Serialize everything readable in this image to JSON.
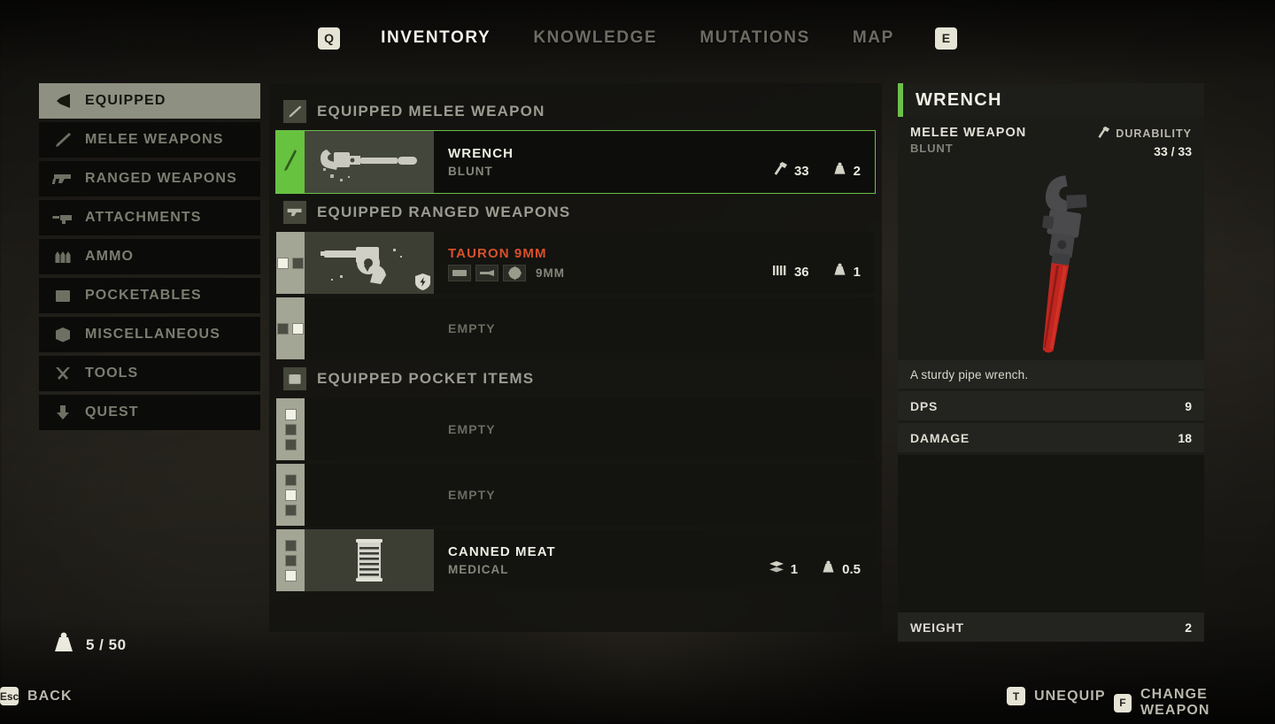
{
  "nav": {
    "left_key": "Q",
    "right_key": "E",
    "tabs": [
      {
        "label": "INVENTORY",
        "active": true
      },
      {
        "label": "KNOWLEDGE",
        "active": false
      },
      {
        "label": "MUTATIONS",
        "active": false
      },
      {
        "label": "MAP",
        "active": false
      }
    ]
  },
  "sidebar": {
    "items": [
      {
        "label": "EQUIPPED",
        "icon": "equipped-icon",
        "active": true
      },
      {
        "label": "MELEE WEAPONS",
        "icon": "blade-icon",
        "active": false
      },
      {
        "label": "RANGED WEAPONS",
        "icon": "pistol-icon",
        "active": false
      },
      {
        "label": "ATTACHMENTS",
        "icon": "attachment-icon",
        "active": false
      },
      {
        "label": "AMMO",
        "icon": "bullets-icon",
        "active": false
      },
      {
        "label": "POCKETABLES",
        "icon": "pouch-icon",
        "active": false
      },
      {
        "label": "MISCELLANEOUS",
        "icon": "box-icon",
        "active": false
      },
      {
        "label": "TOOLS",
        "icon": "tools-icon",
        "active": false
      },
      {
        "label": "QUEST",
        "icon": "quest-arrow-icon",
        "active": false
      }
    ]
  },
  "carry_weight": {
    "icon": "weight-icon",
    "value": "5 / 50"
  },
  "sections": [
    {
      "title": "EQUIPPED MELEE WEAPON",
      "icon": "blade-icon",
      "rows": [
        {
          "selected": true,
          "empty": false,
          "slot_type": "blade",
          "thumb": "wrench-thumb",
          "name": "WRENCH",
          "name_accent": false,
          "subtitle": "BLUNT",
          "stats": [
            {
              "icon": "durability-hammer-icon",
              "value": "33"
            },
            {
              "icon": "weight-icon",
              "value": "2"
            }
          ]
        }
      ]
    },
    {
      "title": "EQUIPPED RANGED WEAPONS",
      "icon": "pistol-icon",
      "rows": [
        {
          "selected": false,
          "empty": false,
          "slot_type": "pips-h",
          "pips": [
            true,
            false
          ],
          "thumb": "revolver-thumb",
          "badge": "shield-bolt-icon",
          "name": "TAURON 9MM",
          "name_accent": true,
          "attachments": [
            "magazine-slot-icon",
            "muzzle-slot-icon",
            "sight-slot-icon"
          ],
          "calibre": "9MM",
          "stats": [
            {
              "icon": "ammo-icon",
              "value": "36"
            },
            {
              "icon": "weight-icon",
              "value": "1"
            }
          ]
        },
        {
          "selected": false,
          "empty": true,
          "slot_type": "pips-h",
          "pips": [
            false,
            true
          ],
          "empty_label": "EMPTY"
        }
      ]
    },
    {
      "title": "EQUIPPED POCKET ITEMS",
      "icon": "pouch-icon",
      "rows": [
        {
          "selected": false,
          "empty": true,
          "slot_type": "pips-v",
          "pips": [
            true,
            false,
            false
          ],
          "empty_label": "EMPTY"
        },
        {
          "selected": false,
          "empty": true,
          "slot_type": "pips-v",
          "pips": [
            false,
            true,
            false
          ],
          "empty_label": "EMPTY"
        },
        {
          "selected": false,
          "empty": false,
          "slot_type": "pips-v",
          "pips": [
            false,
            false,
            true
          ],
          "thumb": "canned-meat-thumb",
          "name": "CANNED MEAT",
          "name_accent": false,
          "subtitle": "MEDICAL",
          "stats": [
            {
              "icon": "stack-icon",
              "value": "1"
            },
            {
              "icon": "weight-icon",
              "value": "0.5"
            }
          ]
        }
      ]
    }
  ],
  "detail": {
    "title": "WRENCH",
    "accent_color": "#6cc04a",
    "type": "MELEE WEAPON",
    "subtype": "BLUNT",
    "durability_label": "DURABILITY",
    "durability_icon": "durability-hammer-icon",
    "durability_value": "33 / 33",
    "art": "wrench-art",
    "description": "A sturdy pipe wrench.",
    "stats": [
      {
        "key": "DPS",
        "value": "9"
      },
      {
        "key": "DAMAGE",
        "value": "18"
      }
    ],
    "weight": {
      "key": "WEIGHT",
      "value": "2"
    }
  },
  "bottom_hints": [
    {
      "key": "Esc",
      "label": "BACK"
    },
    {
      "key": "T",
      "label": "UNEQUIP"
    },
    {
      "key": "F",
      "label": "CHANGE WEAPON"
    }
  ]
}
